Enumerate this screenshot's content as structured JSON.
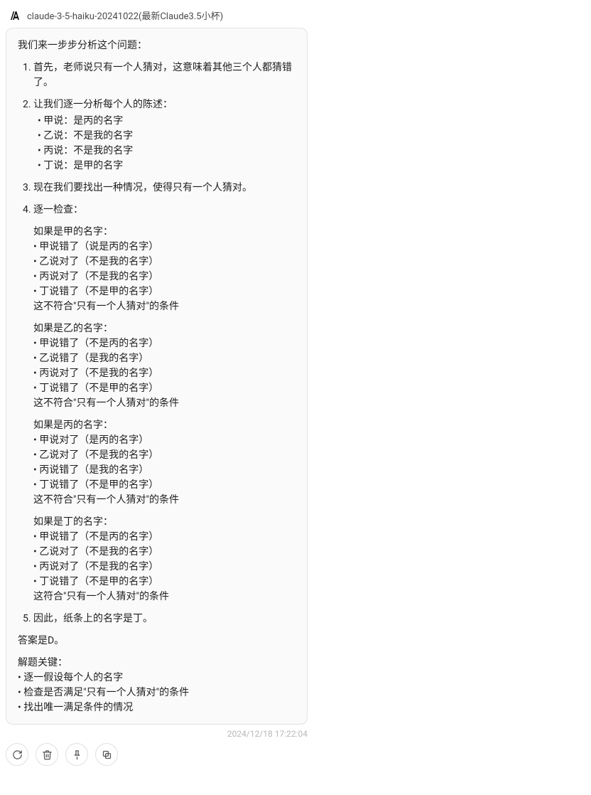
{
  "header": {
    "model": "claude-3-5-haiku-20241022(最新Claude3.5小杯)"
  },
  "message": {
    "intro": "我们来一步步分析这个问题：",
    "items": [
      {
        "text": "首先，老师说只有一个人猜对，这意味着其他三个人都猜错了。"
      },
      {
        "text": "让我们逐一分析每个人的陈述：",
        "bullets": [
          "甲说：是丙的名字",
          "乙说：不是我的名字",
          "丙说：不是我的名字",
          "丁说：是甲的名字"
        ]
      },
      {
        "text": "现在我们要找出一种情况，使得只有一个人猜对。"
      },
      {
        "text": "逐一检查：",
        "cases": [
          {
            "title": "如果是甲的名字：",
            "lines": [
              "甲说错了（说是丙的名字）",
              "乙说对了（不是我的名字）",
              "丙说对了（不是我的名字）",
              "丁说错了（不是甲的名字）"
            ],
            "note": "这不符合\"只有一个人猜对\"的条件"
          },
          {
            "title": "如果是乙的名字：",
            "lines": [
              "甲说错了（不是丙的名字）",
              "乙说错了（是我的名字）",
              "丙说对了（不是我的名字）",
              "丁说错了（不是甲的名字）"
            ],
            "note": "这不符合\"只有一个人猜对\"的条件"
          },
          {
            "title": "如果是丙的名字：",
            "lines": [
              "甲说对了（是丙的名字）",
              "乙说对了（不是我的名字）",
              "丙说错了（是我的名字）",
              "丁说错了（不是甲的名字）"
            ],
            "note": "这不符合\"只有一个人猜对\"的条件"
          },
          {
            "title": "如果是丁的名字：",
            "lines": [
              "甲说错了（不是丙的名字）",
              "乙说对了（不是我的名字）",
              "丙说对了（不是我的名字）",
              "丁说错了（不是甲的名字）"
            ],
            "note": "这符合\"只有一个人猜对\"的条件"
          }
        ]
      },
      {
        "text": "因此，纸条上的名字是丁。"
      }
    ],
    "answer": "答案是D。",
    "key_title": "解题关键：",
    "key_points": [
      "逐一假设每个人的名字",
      "检查是否满足\"只有一个人猜对\"的条件",
      "找出唯一满足条件的情况"
    ]
  },
  "timestamp": "2024/12/18 17:22:04"
}
